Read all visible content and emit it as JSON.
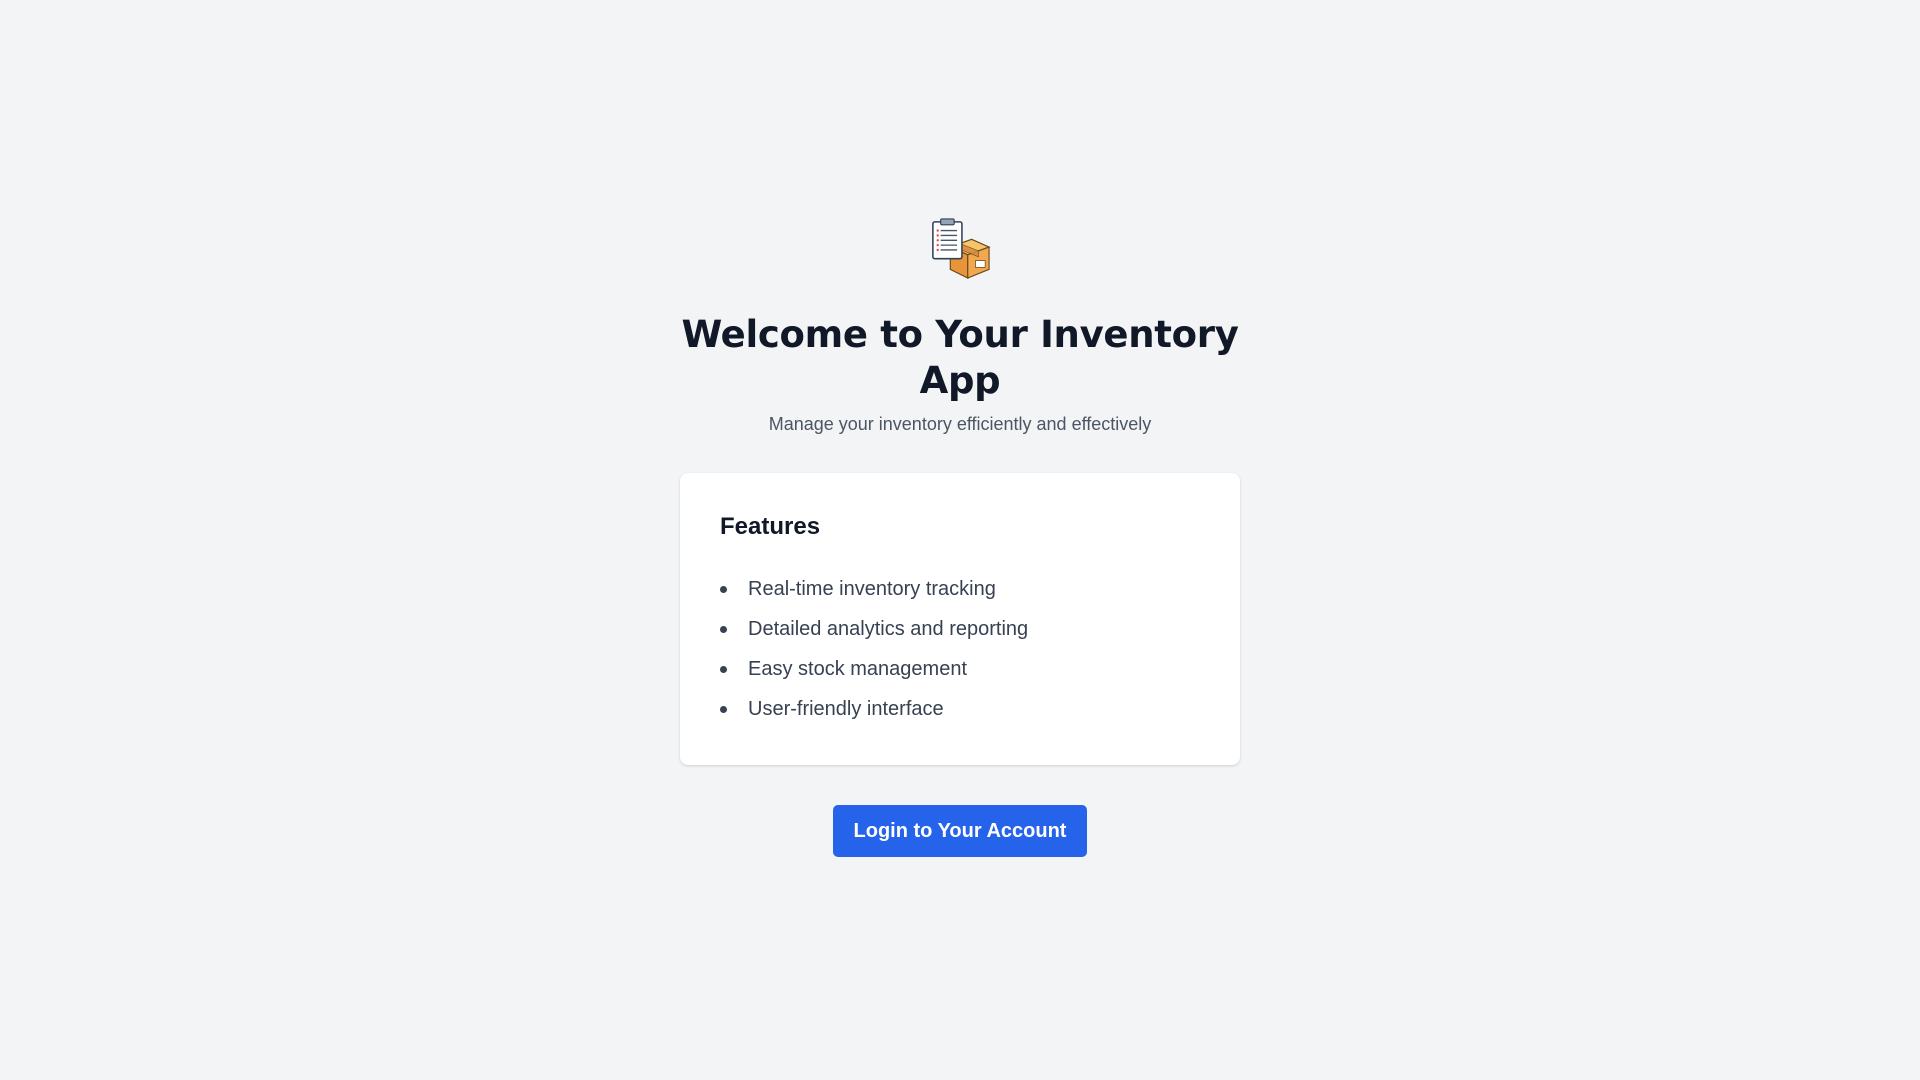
{
  "hero": {
    "icon": "clipboard-box-icon",
    "title": "Welcome to Your Inventory App",
    "subtitle": "Manage your inventory efficiently and effectively"
  },
  "features": {
    "heading": "Features",
    "items": [
      "Real-time inventory tracking",
      "Detailed analytics and reporting",
      "Easy stock management",
      "User-friendly interface"
    ]
  },
  "actions": {
    "login_label": "Login to Your Account"
  },
  "colors": {
    "background": "#f3f4f6",
    "primary": "#2563eb",
    "heading": "#111827",
    "body_text": "#374151",
    "muted_text": "#4b5563",
    "card": "#ffffff"
  }
}
